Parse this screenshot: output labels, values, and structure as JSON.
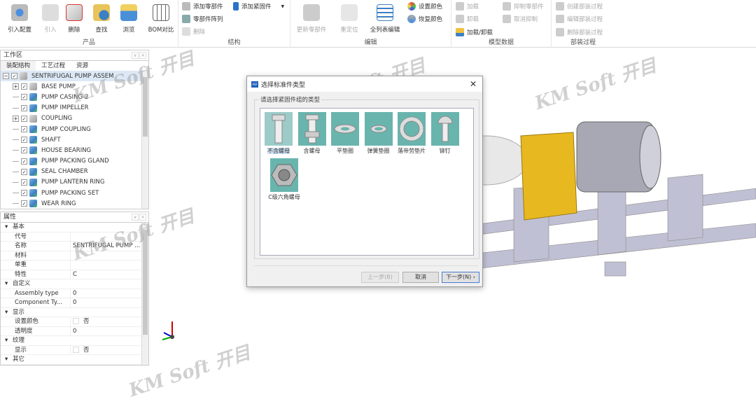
{
  "ribbon": {
    "groups": {
      "product": "产品",
      "structure": "结构",
      "edit": "编辑",
      "model_data": "模型数据",
      "assembly_process": "部装过程"
    },
    "import_config": "引入配置",
    "import": "引入",
    "delete": "删除",
    "find": "查找",
    "browse": "浏览",
    "bom_compare": "BOM对比",
    "add_part": "添加零部件",
    "add_fastener": "添加紧固件",
    "part_array": "零部件阵列",
    "struct_delete": "删除",
    "update_part": "更新零部件",
    "reposition": "重定位",
    "full_list_edit": "全列表编辑",
    "set_color": "设置颜色",
    "restore_color": "恢复颜色",
    "load": "加载",
    "unload": "卸载",
    "load_unload": "加载/卸载",
    "suppress_part": "抑制零部件",
    "cancel_suppress": "取消抑制",
    "create_process": "创建部装过程",
    "edit_process": "编辑部装过程",
    "delete_process": "删除部装过程"
  },
  "workspace": {
    "title": "工作区",
    "tabs": [
      "装配结构",
      "工艺过程",
      "资源"
    ],
    "root": "SENTRIFUGAL PUMP ASSEM",
    "items": [
      {
        "label": "BASE PUMP",
        "expandable": true
      },
      {
        "label": "PUMP CASING-2"
      },
      {
        "label": "PUMP IMPELLER"
      },
      {
        "label": "COUPLING",
        "expandable": true
      },
      {
        "label": "PUMP COUPLING"
      },
      {
        "label": "SHAFT"
      },
      {
        "label": "HOUSE BEARING"
      },
      {
        "label": "PUMP PACKING GLAND"
      },
      {
        "label": "SEAL CHAMBER"
      },
      {
        "label": "PUMP LANTERN RING"
      },
      {
        "label": "PUMP PACKING SET"
      },
      {
        "label": "WEAR RING"
      }
    ]
  },
  "properties": {
    "title": "属性",
    "rows": [
      {
        "cat": "基本"
      },
      {
        "k": "代号",
        "v": ""
      },
      {
        "k": "名称",
        "v": "SENTRIFUGAL PUMP ..."
      },
      {
        "k": "材料",
        "v": ""
      },
      {
        "k": "单重",
        "v": ""
      },
      {
        "k": "特性",
        "v": "C"
      },
      {
        "cat": "自定义"
      },
      {
        "k": "Assembly type",
        "v": "0"
      },
      {
        "k": "Component Ty...",
        "v": "0"
      },
      {
        "cat": "显示"
      },
      {
        "k": "设置颜色",
        "v": "否",
        "checkbox": true
      },
      {
        "k": "透明度",
        "v": "0"
      },
      {
        "cat": "纹理"
      },
      {
        "k": "显示",
        "v": "否",
        "checkbox": true
      },
      {
        "cat": "其它"
      }
    ]
  },
  "dialog": {
    "title": "选择标准件类型",
    "group_label": "请选择紧固件组的类型",
    "types": [
      "不含螺母",
      "含螺母",
      "平垫圈",
      "弹簧垫圈",
      "落帝劳垫片",
      "铆钉",
      "C级六角螺母"
    ],
    "selected": "不含螺母",
    "prev": "上一步(B)",
    "cancel": "取消",
    "next": "下一步(N)"
  },
  "watermark": "KM Soft 开目",
  "colors": {
    "accent": "#6ab4ae",
    "motor_yellow": "#e8b820",
    "frame": "#b8b8cc"
  }
}
